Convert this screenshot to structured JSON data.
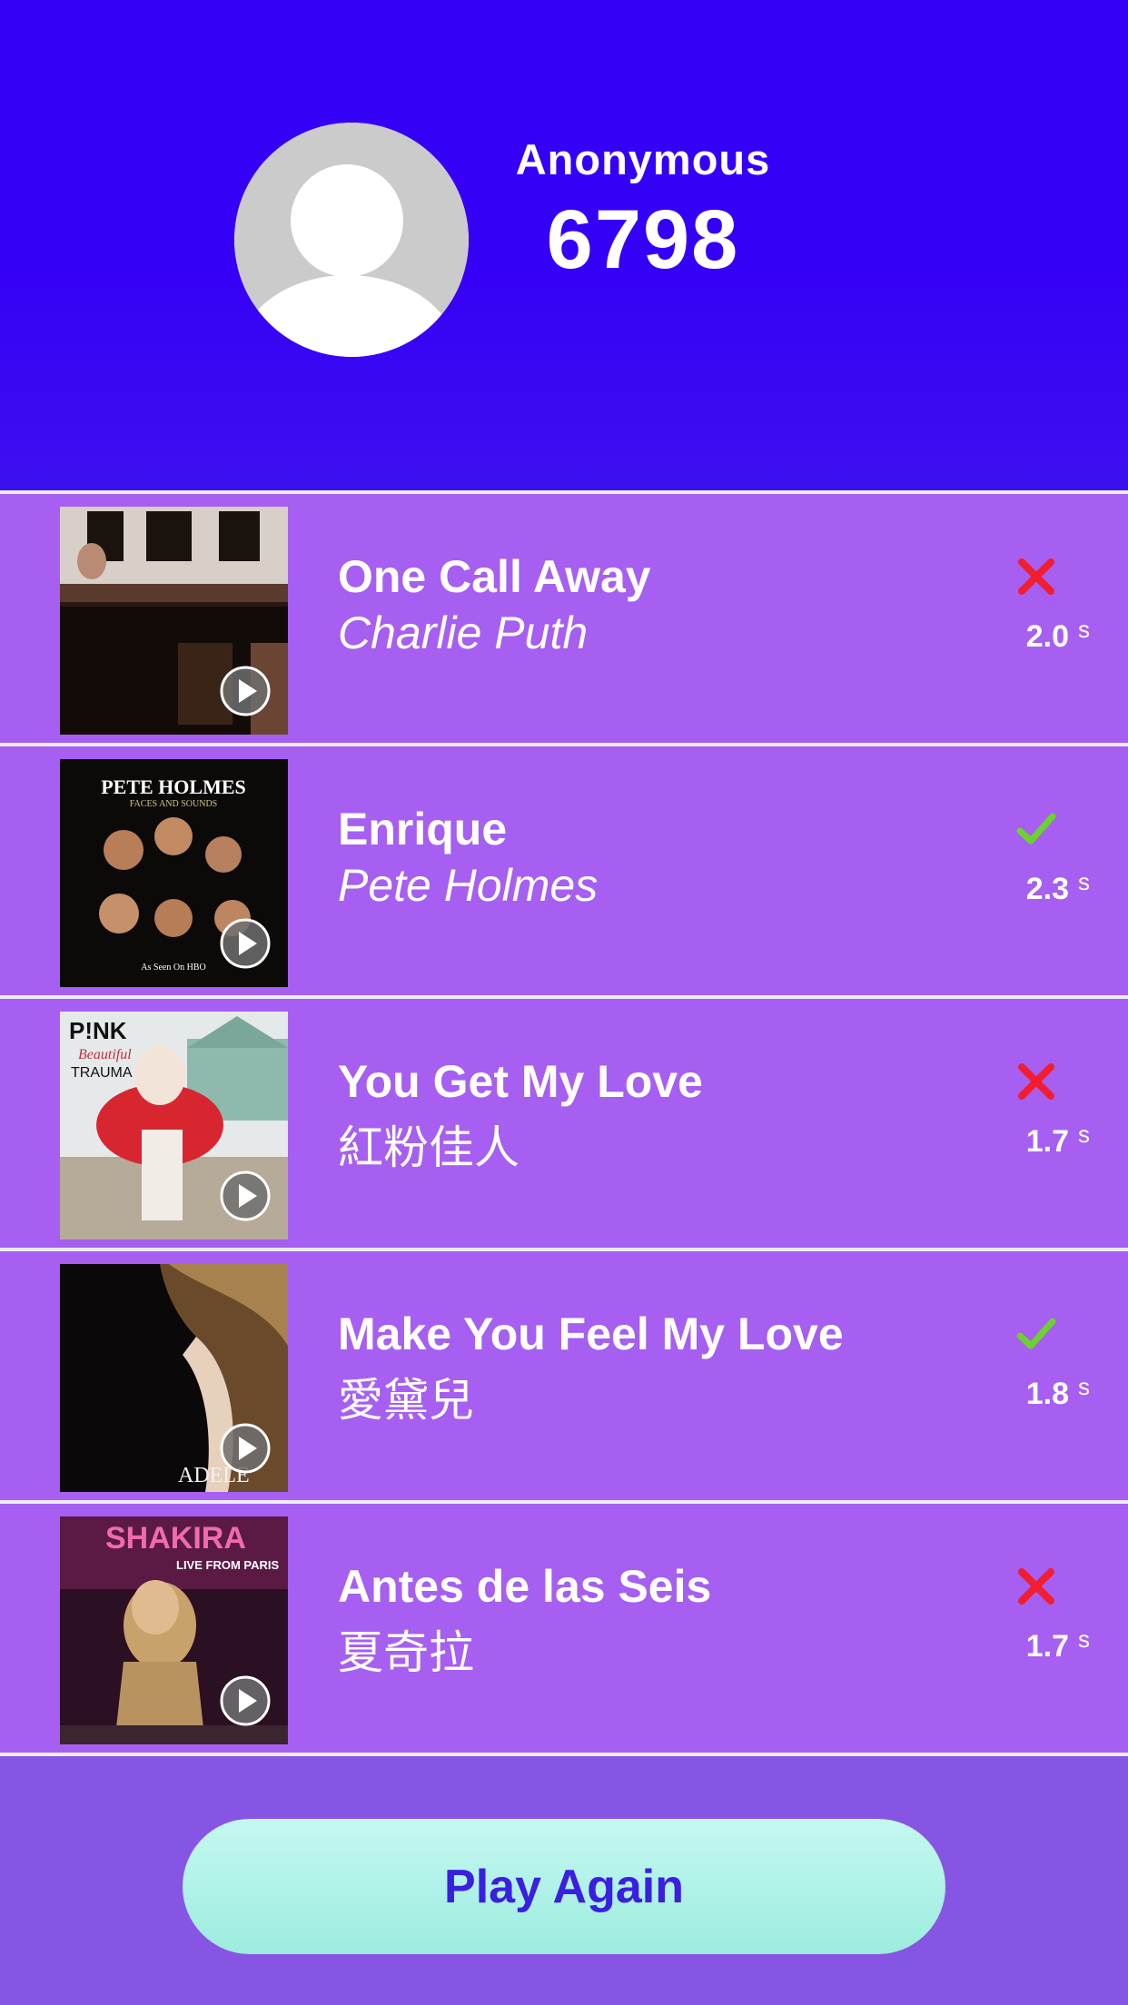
{
  "profile": {
    "username": "Anonymous",
    "score": "6798",
    "avatar_icon": "default-user-avatar-icon"
  },
  "songs": [
    {
      "title": "One Call Away",
      "artist": "Charlie Puth",
      "artist_italic": true,
      "result": "wrong",
      "time": "2.0",
      "unit": "s"
    },
    {
      "title": "Enrique",
      "artist": "Pete Holmes",
      "artist_italic": true,
      "result": "correct",
      "time": "2.3",
      "unit": "s",
      "cover_text_top": "PETE HOLMES",
      "cover_text_sub": "FACES AND SOUNDS",
      "cover_text_bottom": "As Seen On HBO"
    },
    {
      "title": "You Get My Love",
      "artist": "紅粉佳人",
      "artist_italic": false,
      "result": "wrong",
      "time": "1.7",
      "unit": "s",
      "cover_text_top": "P!NK",
      "cover_text_sub": "Beautiful",
      "cover_text_bottom": "TRAUMA"
    },
    {
      "title": "Make You Feel My Love",
      "artist": "愛黛兒",
      "artist_italic": false,
      "result": "correct",
      "time": "1.8",
      "unit": "s",
      "cover_text_bottom": "ADELE"
    },
    {
      "title": "Antes de las Seis",
      "artist": "夏奇拉",
      "artist_italic": false,
      "result": "wrong",
      "time": "1.7",
      "unit": "s",
      "cover_text_top": "SHAKIRA",
      "cover_text_sub": "LIVE FROM PARIS"
    }
  ],
  "icons": {
    "play": "play-circle-icon",
    "correct": "checkmark-icon",
    "wrong": "cross-icon"
  },
  "colors": {
    "header_bg": "#3500f6",
    "row_bg": "#a65ff0",
    "footer_bg": "#8755e4",
    "correct": "#6cd22e",
    "wrong": "#f21d2f",
    "button_text": "#3a1fe0"
  },
  "footer": {
    "play_again_label": "Play Again"
  }
}
